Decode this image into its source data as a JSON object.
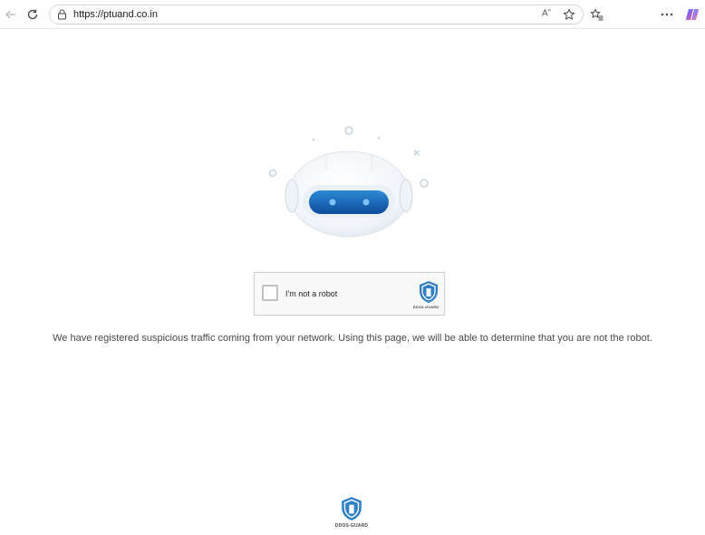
{
  "browser": {
    "url": "https://ptuand.co.in",
    "read_aloud_label": "A"
  },
  "captcha": {
    "label": "I'm not a robot",
    "brand": "DDOS-GUARD"
  },
  "message": "We have registered suspicious traffic coming from your network. Using this page, we will be able to determine that you are not the robot.",
  "footer": {
    "brand": "DDOS-GUARD"
  },
  "colors": {
    "accent": "#1f6fb8",
    "shield": "#2f7fc6",
    "text": "#4a4a4a"
  }
}
